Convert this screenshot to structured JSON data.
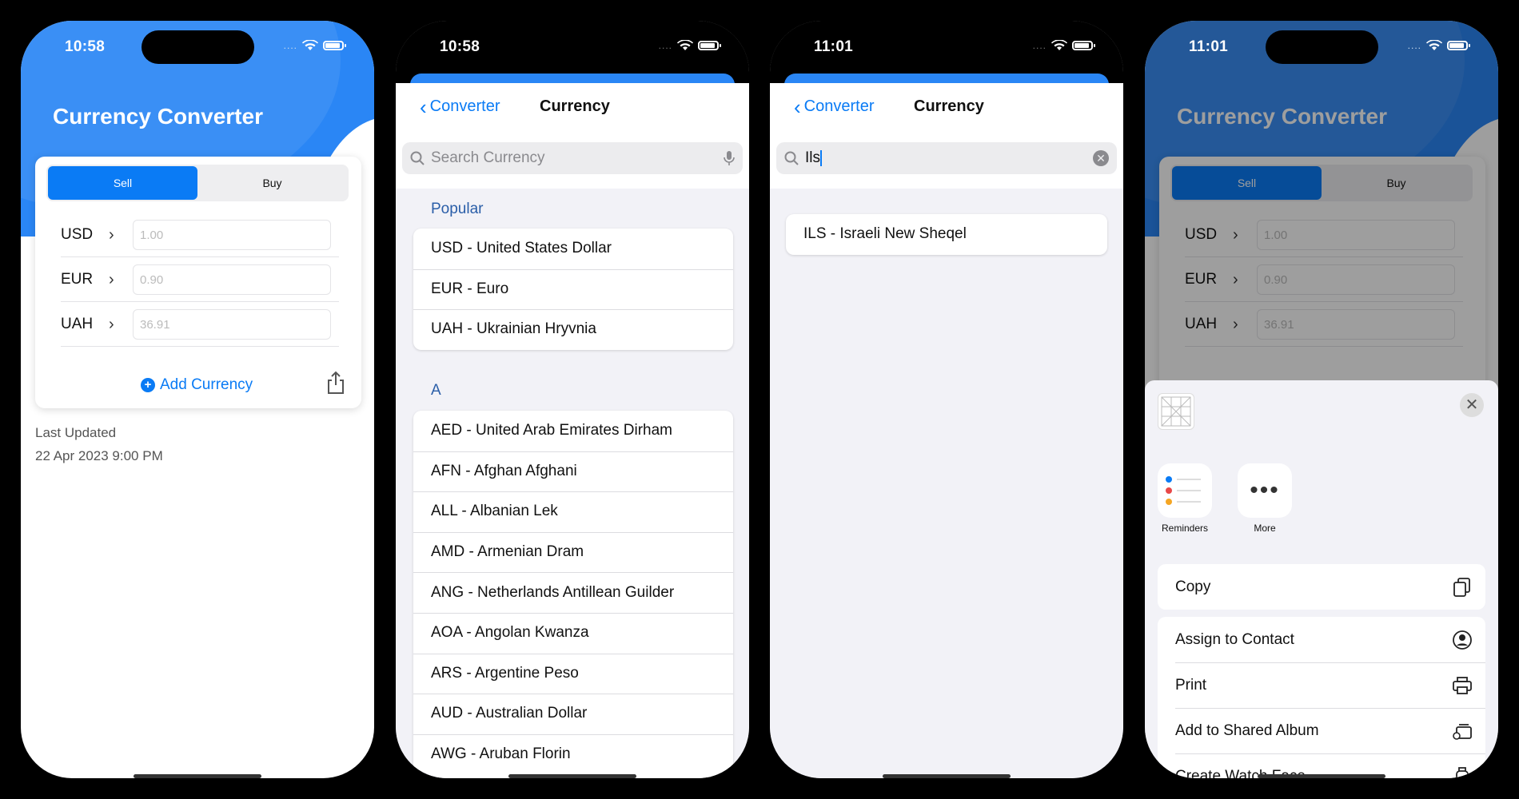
{
  "status": {
    "p1_time": "10:58",
    "p2_time": "10:58",
    "p3_time": "11:01",
    "p4_time": "11:01",
    "dots": "....",
    "icons": [
      "signal-dots-icon",
      "wifi-icon",
      "battery-icon"
    ]
  },
  "converter": {
    "title": "Currency Converter",
    "segments": [
      "Sell",
      "Buy"
    ],
    "selected_segment": "Sell",
    "rows": [
      {
        "code": "USD",
        "value": "1.00"
      },
      {
        "code": "EUR",
        "value": "0.90"
      },
      {
        "code": "UAH",
        "value": "36.91"
      }
    ],
    "add_label": "Add Currency",
    "last_updated_label": "Last Updated",
    "last_updated_value": "22 Apr 2023 9:00 PM"
  },
  "picker": {
    "back_label": "Converter",
    "title": "Currency",
    "search_placeholder": "Search Currency",
    "search_value": "Ils",
    "popular_header": "Popular",
    "popular": [
      "USD - United States Dollar",
      "EUR - Euro",
      "UAH - Ukrainian Hryvnia"
    ],
    "a_header": "A",
    "a_list": [
      "AED - United Arab Emirates Dirham",
      "AFN - Afghan Afghani",
      "ALL - Albanian Lek",
      "AMD - Armenian Dram",
      "ANG - Netherlands Antillean Guilder",
      "AOA - Angolan Kwanza",
      "ARS - Argentine Peso",
      "AUD - Australian Dollar",
      "AWG - Aruban Florin"
    ],
    "search_result": "ILS - Israeli New Sheqel"
  },
  "share_sheet": {
    "apps": [
      "Reminders",
      "More"
    ],
    "actions": [
      "Copy",
      "Assign to Contact",
      "Print",
      "Add to Shared Album",
      "Create Watch Face"
    ]
  },
  "colors": {
    "accent": "#0a7bf5",
    "header_blue": "#2a86f5"
  }
}
